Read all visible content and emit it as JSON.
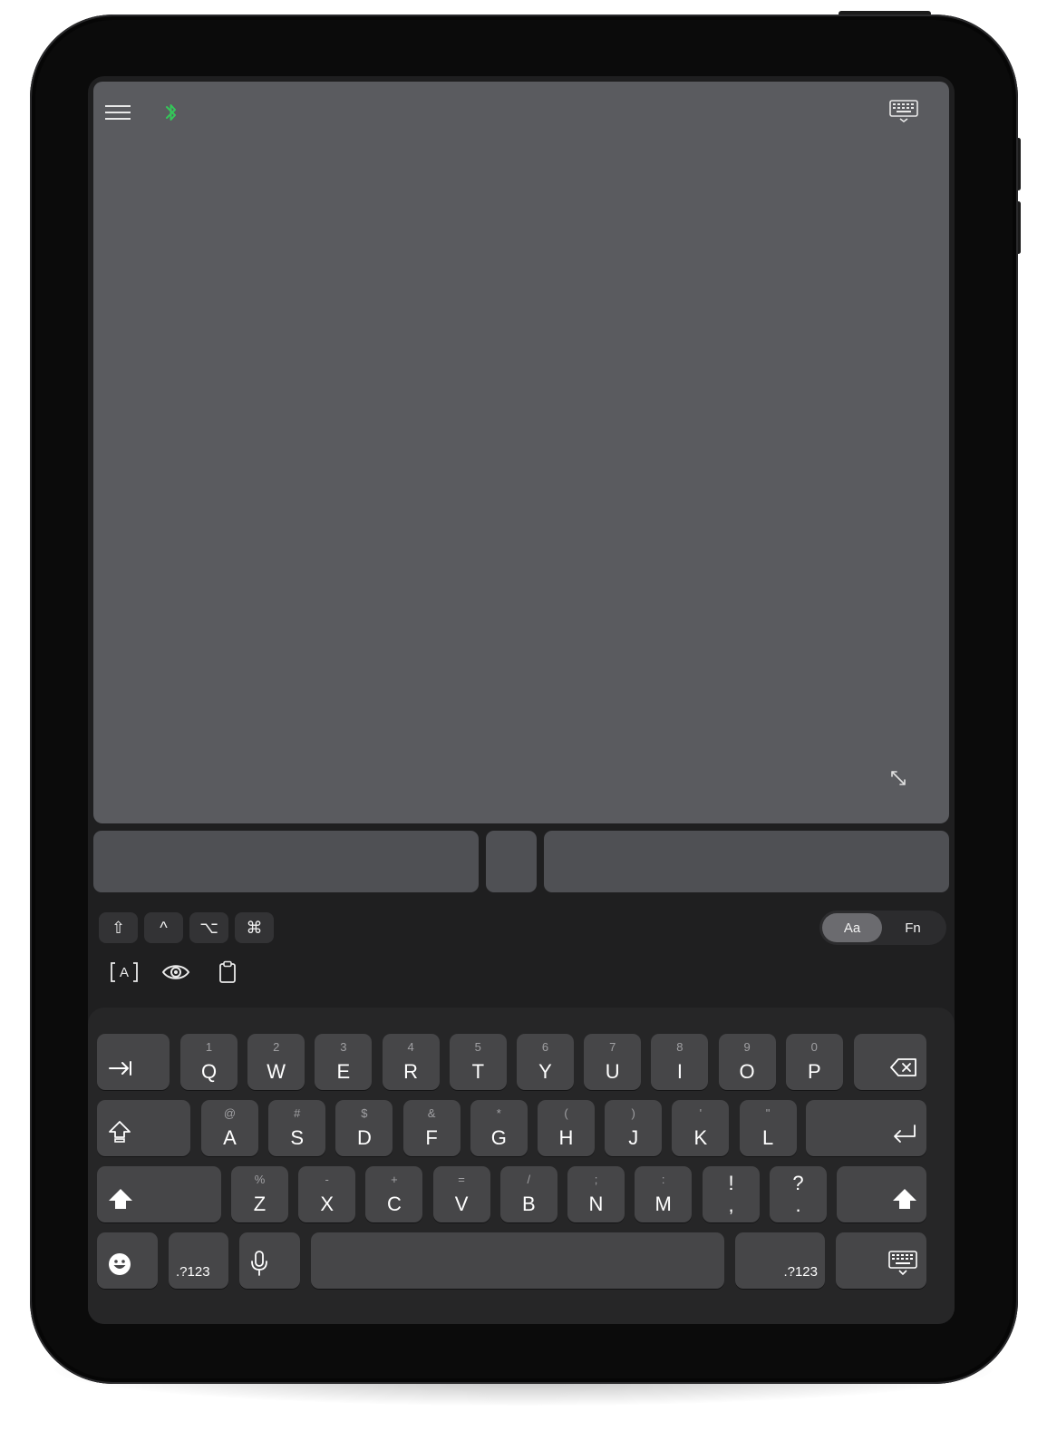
{
  "toolbar": {
    "menu_icon": "hamburger-menu-icon",
    "bluetooth_icon": "bluetooth-icon",
    "bluetooth_color": "#34c759",
    "keyboard_icon": "keyboard-icon",
    "expand_icon": "expand-arrows-icon"
  },
  "modifiers": {
    "shift": "⇧",
    "control": "^",
    "option": "⌥",
    "command": "⌘"
  },
  "mode_toggle": {
    "letters": "Aa",
    "function": "Fn",
    "selected": "Aa"
  },
  "tools": {
    "text_input_icon": "text-input-icon",
    "text_input_label": "A",
    "eye_icon": "eye-icon",
    "clipboard_icon": "clipboard-icon"
  },
  "keyboard": {
    "row1": [
      {
        "hint": "1",
        "label": "Q"
      },
      {
        "hint": "2",
        "label": "W"
      },
      {
        "hint": "3",
        "label": "E"
      },
      {
        "hint": "4",
        "label": "R"
      },
      {
        "hint": "5",
        "label": "T"
      },
      {
        "hint": "6",
        "label": "Y"
      },
      {
        "hint": "7",
        "label": "U"
      },
      {
        "hint": "8",
        "label": "I"
      },
      {
        "hint": "9",
        "label": "O"
      },
      {
        "hint": "0",
        "label": "P"
      }
    ],
    "row2": [
      {
        "hint": "@",
        "label": "A"
      },
      {
        "hint": "#",
        "label": "S"
      },
      {
        "hint": "$",
        "label": "D"
      },
      {
        "hint": "&",
        "label": "F"
      },
      {
        "hint": "*",
        "label": "G"
      },
      {
        "hint": "(",
        "label": "H"
      },
      {
        "hint": ")",
        "label": "J"
      },
      {
        "hint": "'",
        "label": "K"
      },
      {
        "hint": "\"",
        "label": "L"
      }
    ],
    "row3": [
      {
        "hint": "%",
        "label": "Z"
      },
      {
        "hint": "-",
        "label": "X"
      },
      {
        "hint": "+",
        "label": "C"
      },
      {
        "hint": "=",
        "label": "V"
      },
      {
        "hint": "/",
        "label": "B"
      },
      {
        "hint": ";",
        "label": "N"
      },
      {
        "hint": ":",
        "label": "M"
      }
    ],
    "punct1": {
      "top": "!",
      "bottom": ","
    },
    "punct2": {
      "top": "?",
      "bottom": "."
    },
    "numbers_left": ".?123",
    "numbers_right": ".?123",
    "icons": {
      "tab": "tab-icon",
      "delete": "delete-backspace-icon",
      "caps": "caps-lock-icon",
      "return": "return-icon",
      "shift_left": "shift-icon",
      "shift_right": "shift-icon",
      "emoji": "emoji-icon",
      "mic": "microphone-icon",
      "hide": "keyboard-dismiss-icon"
    }
  }
}
